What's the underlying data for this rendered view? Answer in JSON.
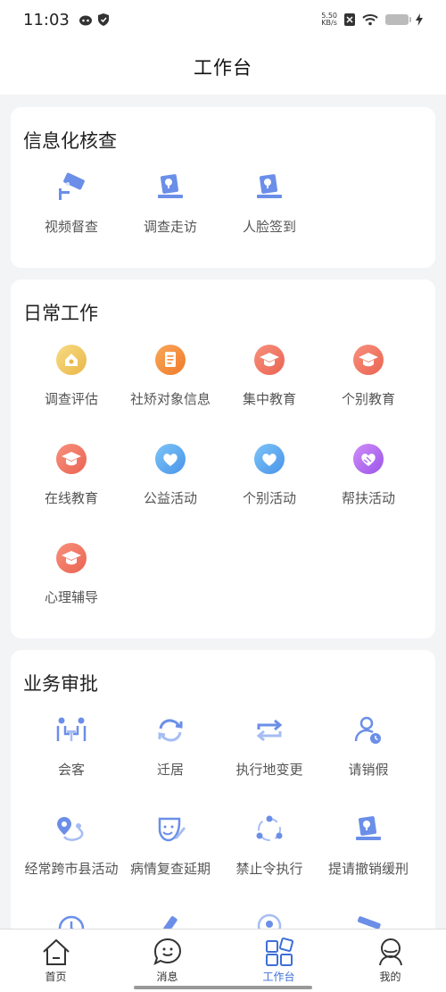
{
  "status": {
    "time": "11:03",
    "net_speed_value": "5.50",
    "net_speed_unit": "KB/s"
  },
  "header": {
    "title": "工作台"
  },
  "sections": {
    "info_check": {
      "title": "信息化核查",
      "items": [
        {
          "label": "视频督查",
          "icon": "surveillance-camera-icon"
        },
        {
          "label": "调查走访",
          "icon": "stamp-icon"
        },
        {
          "label": "人脸签到",
          "icon": "stamp-icon"
        }
      ]
    },
    "daily_work": {
      "title": "日常工作",
      "items": [
        {
          "label": "调查评估",
          "icon": "house-coin-icon"
        },
        {
          "label": "社矫对象信息",
          "icon": "document-icon"
        },
        {
          "label": "集中教育",
          "icon": "graduation-cap-icon"
        },
        {
          "label": "个别教育",
          "icon": "graduation-cap-icon"
        },
        {
          "label": "在线教育",
          "icon": "graduation-cap-icon"
        },
        {
          "label": "公益活动",
          "icon": "heart-icon"
        },
        {
          "label": "个别活动",
          "icon": "heart-icon"
        },
        {
          "label": "帮扶活动",
          "icon": "hands-heart-icon"
        },
        {
          "label": "心理辅导",
          "icon": "graduation-cap-icon"
        }
      ]
    },
    "approval": {
      "title": "业务审批",
      "items": [
        {
          "label": "会客",
          "icon": "meeting-icon"
        },
        {
          "label": "迁居",
          "icon": "refresh-icon"
        },
        {
          "label": "执行地变更",
          "icon": "swap-arrows-icon"
        },
        {
          "label": "请销假",
          "icon": "user-clock-icon"
        },
        {
          "label": "经常跨市县活动",
          "icon": "route-pin-icon"
        },
        {
          "label": "病情复查延期",
          "icon": "medical-edit-icon"
        },
        {
          "label": "禁止令执行",
          "icon": "cycle-nodes-icon"
        },
        {
          "label": "提请撤销缓刑",
          "icon": "stamp-icon"
        }
      ]
    }
  },
  "tabbar": {
    "items": [
      {
        "label": "首页",
        "icon": "home-icon"
      },
      {
        "label": "消息",
        "icon": "message-icon"
      },
      {
        "label": "工作台",
        "icon": "workbench-icon"
      },
      {
        "label": "我的",
        "icon": "profile-icon"
      }
    ],
    "active_index": 2
  },
  "colors": {
    "accent": "#3d6fd6",
    "icon_blue": "#6b8fe8",
    "orange": "#f58a3c",
    "red_coral": "#f07a6a",
    "sky_blue": "#5aa8f0",
    "purple": "#b06bf0",
    "gold": "#f0c85a"
  }
}
